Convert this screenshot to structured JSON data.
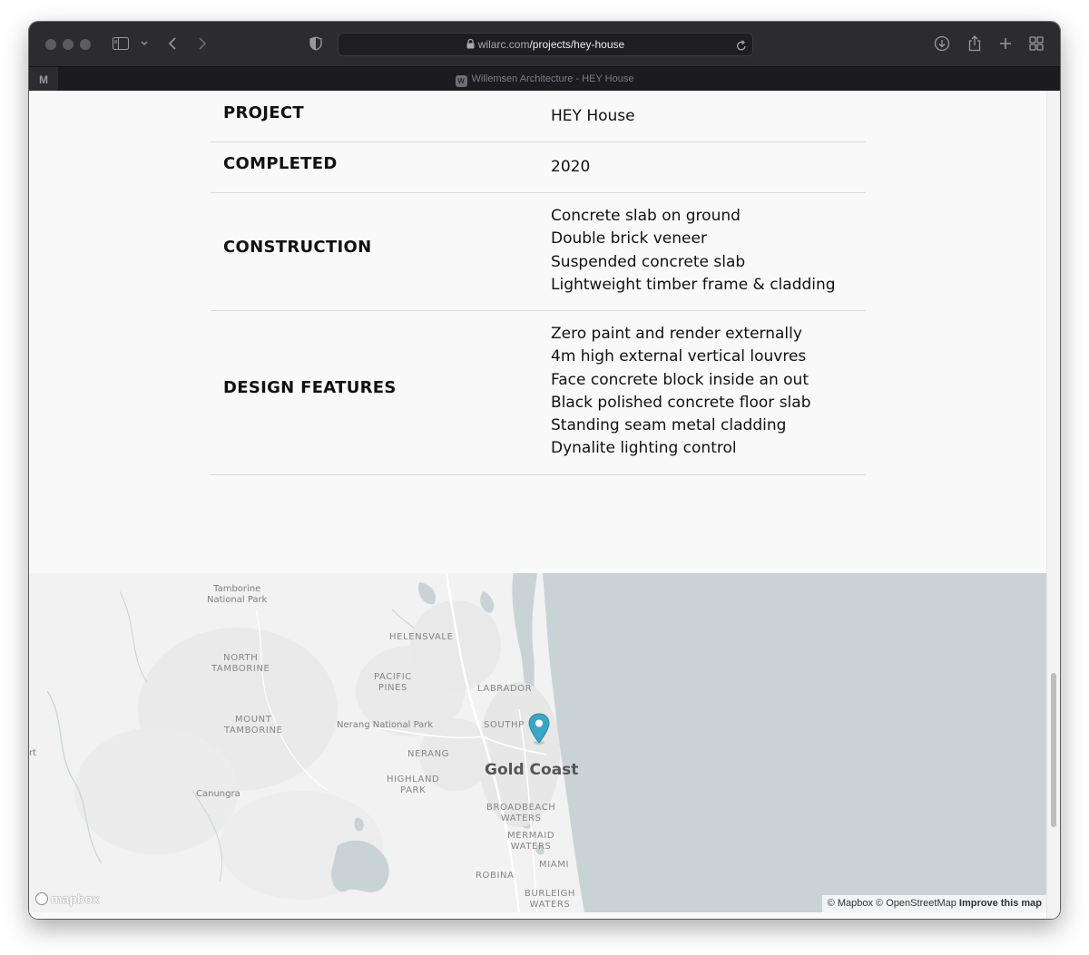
{
  "browser": {
    "url_host": "wilarc.com",
    "url_path": "/projects/hey-house",
    "tab_title": "Willemsen Architecture - HEY House",
    "pinned_tab_letter": "M",
    "tab_favicon_letter": "W"
  },
  "project_details": {
    "rows": [
      {
        "label": "PROJECT",
        "values": [
          "HEY House"
        ]
      },
      {
        "label": "COMPLETED",
        "values": [
          "2020"
        ]
      },
      {
        "label": "CONSTRUCTION",
        "values": [
          "Concrete slab on ground",
          "Double brick veneer",
          "Suspended concrete slab",
          "Lightweight timber frame & cladding"
        ]
      },
      {
        "label": "DESIGN FEATURES",
        "values": [
          "Zero paint and render externally",
          "4m high external vertical louvres",
          "Face concrete block inside an out",
          "Black polished concrete floor slab",
          "Standing seam metal cladding",
          "Dynalite lighting control"
        ]
      }
    ]
  },
  "map": {
    "labels": {
      "tamborine_np": "Tamborine\nNational Park",
      "helensvale": "HELENSVALE",
      "north_tamborine": "NORTH\nTAMBORINE",
      "pacific_pines": "PACIFIC\nPINES",
      "labrador": "LABRADOR",
      "mount_tamborine": "MOUNT\nTAMBORINE",
      "nerang_np": "Nerang National Park",
      "southport": "SOUTHP",
      "nerang": "NERANG",
      "gold_coast": "Gold Coast",
      "highland_park": "HIGHLAND\nPARK",
      "canungra": "Canungra",
      "broadbeach_waters": "BROADBEACH\nWATERS",
      "mermaid_waters": "MERMAID\nWATERS",
      "miami": "MIAMI",
      "robina": "ROBINA",
      "burleigh_waters": "BURLEIGH\nWATERS",
      "edge_rt": "rt"
    },
    "logo_text": "mapbox",
    "attribution": {
      "mapbox": "© Mapbox",
      "osm": "© OpenStreetMap",
      "improve": "Improve this map"
    },
    "colors": {
      "land": "#f1f2f1",
      "water": "#c9d3d5",
      "marker": "#3aa6c4"
    }
  }
}
